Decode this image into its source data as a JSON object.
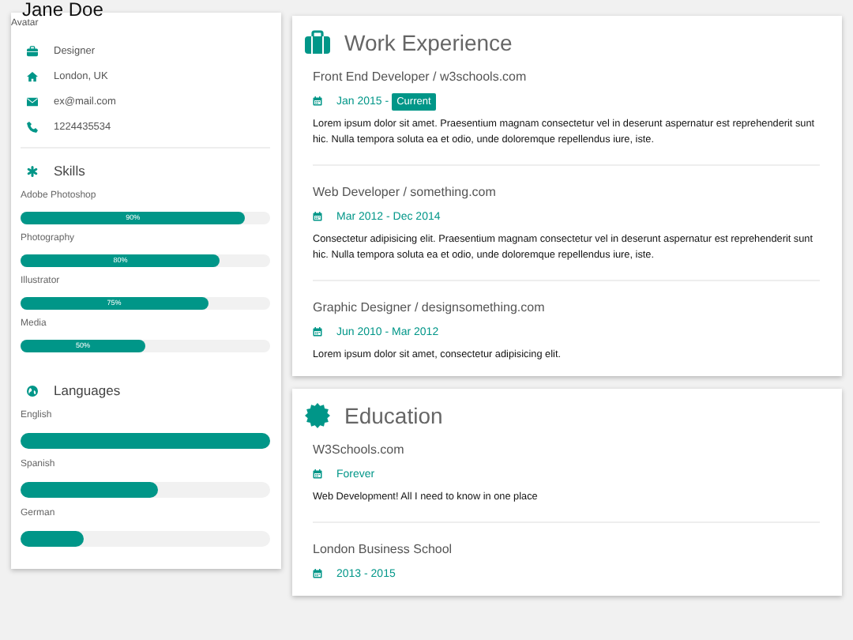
{
  "profile": {
    "name": "Jane Doe",
    "avatar_alt": "Avatar",
    "info": [
      {
        "kind": "job",
        "text": "Designer"
      },
      {
        "kind": "home",
        "text": "London, UK"
      },
      {
        "kind": "email",
        "text": "ex@mail.com"
      },
      {
        "kind": "phone",
        "text": "1224435534"
      }
    ]
  },
  "skills": {
    "title": "Skills",
    "items": [
      {
        "name": "Adobe Photoshop",
        "level": 0.9,
        "reading": "90%"
      },
      {
        "name": "Photography",
        "level": 0.8,
        "reading": "80%"
      },
      {
        "name": "Illustrator",
        "level": 0.75,
        "reading": "75%"
      },
      {
        "name": "Media",
        "level": 0.5,
        "reading": "50%"
      }
    ]
  },
  "languages": {
    "title": "Languages",
    "items": [
      {
        "name": "English",
        "level": 1
      },
      {
        "name": "Spanish",
        "level": 0.55
      },
      {
        "name": "German",
        "level": 0.25
      }
    ]
  },
  "sections": [
    {
      "kind": "work",
      "title": "Work Experience",
      "entries": [
        {
          "title": "Front End Developer / w3schools.com",
          "date": "Jan 2015 -",
          "badge": "Current",
          "text": "Lorem ipsum dolor sit amet. Praesentium magnam consectetur vel in deserunt aspernatur est reprehenderit sunt hic. Nulla tempora soluta ea et odio, unde doloremque repellendus iure, iste."
        },
        {
          "title": "Web Developer / something.com",
          "date": "Mar 2012 - Dec 2014",
          "text": "Consectetur adipisicing elit. Praesentium magnam consectetur vel in deserunt aspernatur est reprehenderit sunt hic. Nulla tempora soluta ea et odio, unde doloremque repellendus iure, iste."
        },
        {
          "title": "Graphic Designer / designsomething.com",
          "date": "Jun 2010 - Mar 2012",
          "text": "Lorem ipsum dolor sit amet, consectetur adipisicing elit."
        }
      ]
    },
    {
      "kind": "education",
      "title": "Education",
      "entries": [
        {
          "title": "W3Schools.com",
          "date": "Forever",
          "text": "Web Development! All I need to know in one place"
        },
        {
          "title": "London Business School",
          "date": "2013 - 2015"
        }
      ]
    }
  ]
}
